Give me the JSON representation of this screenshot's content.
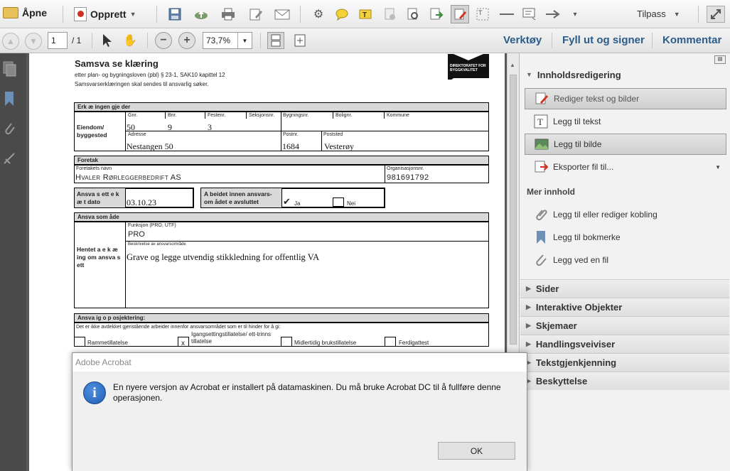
{
  "toolbar": {
    "open_label": "Åpne",
    "create_label": "Opprett",
    "customize_label": "Tilpass"
  },
  "nav": {
    "page_current": "1",
    "page_total": "/ 1",
    "zoom": "73,7%"
  },
  "right_links": {
    "tools": "Verktøy",
    "fill_sign": "Fyll ut og signer",
    "comment": "Kommentar"
  },
  "document": {
    "title": "Samsva se klæring",
    "subtitle1": "etter plan- og bygningsloven (pbl) § 23-1, SAK10 kapittel 12",
    "subtitle2": "Samsvarserklæringen skal sendes til ansvarlig søker.",
    "logo_text": "DIREKTORATET FOR BYGGKVALITET",
    "sec1_header": "Erk æ ingen gje der",
    "sec1_label": "Eiendom/ byggested",
    "col_gnr": "Gnr.",
    "col_bnr": "Bnr.",
    "col_festenr": "Festenr.",
    "col_seksjonsnr": "Seksjonsnr.",
    "col_bygningsnr": "Bygningsnr.",
    "col_bolignr": "Bolignr.",
    "col_kommune": "Kommune",
    "val_gnr": "50",
    "val_bnr": "9",
    "val_festenr": "3",
    "col_adresse": "Adresse",
    "col_postnr": "Postnr.",
    "col_poststed": "Poststed",
    "val_adresse": "Nestangen 50",
    "val_postnr": "1684",
    "val_poststed": "Vesterøy",
    "sec2_header": "Foretak",
    "col_foretak": "Foretakets navn",
    "col_orgnr": "Organisasjonsnr.",
    "val_foretak": "Hvaler Rørleggerbedrift AS",
    "val_orgnr": "981691792",
    "ansv_label": "Ansva s ett e k æ t dato",
    "ansv_date": "03.10.23",
    "arbeid_label": "A beidet innen ansvars- om ådet e avsluttet",
    "check_mark": "✔",
    "ja_label": "Ja",
    "nei_label": "Nei",
    "sec3_header": "Ansva som åde",
    "hentet_label": "Hentet a e k æ ing om ansva s ett",
    "col_funksjon": "Funksjon (PRO, UTF)",
    "val_funksjon": "PRO",
    "col_beskrivelse": "Beskrivelse av ansvarsområde",
    "val_beskrivelse": "Grave og legge utvendig stikkledning for offentlig VA",
    "sec4_header": "Ansva ig o p osjektering:",
    "sec4_note": "Det er ikke avdekket gjenstående arbeider innenfor ansvarsområdet som er til hinder for å gi:",
    "opt1": "Rammetillatelse",
    "opt2_mark": "x",
    "opt2": "Igangsettingstillatelse/ ett-trinns tillatelse",
    "opt3": "Midlertidig brukstillatelse",
    "opt4": "Ferdigattest"
  },
  "panel": {
    "section_content_edit": "Innholdsredigering",
    "edit_text_images": "Rediger tekst og bilder",
    "add_text": "Legg til tekst",
    "add_image": "Legg til bilde",
    "export_file": "Eksporter fil til...",
    "more_content": "Mer innhold",
    "add_link": "Legg til eller rediger kobling",
    "add_bookmark": "Legg til bokmerke",
    "attach_file": "Legg ved en fil",
    "sec_pages": "Sider",
    "sec_interactive": "Interaktive Objekter",
    "sec_forms": "Skjemaer",
    "sec_actions": "Handlingsveiviser",
    "sec_ocr": "Tekstgjenkjenning",
    "sec_protect": "Beskyttelse"
  },
  "dialog": {
    "title": "Adobe Acrobat",
    "message": "En nyere versjon av Acrobat er installert på datamaskinen. Du må bruke Acrobat DC til å fullføre denne operasjonen.",
    "ok_label": "OK",
    "info_icon_glyph": "i"
  },
  "colors": {
    "accent_link": "#2b5c8a",
    "rail": "#4a4a4a",
    "info_icon": "#1f5fb4"
  }
}
